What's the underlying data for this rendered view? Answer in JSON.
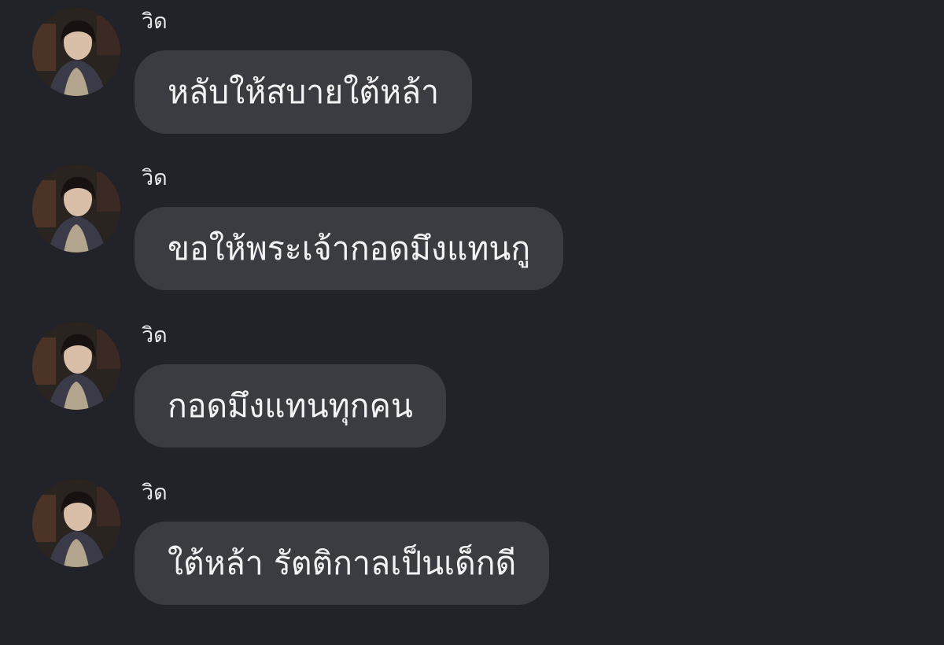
{
  "theme": {
    "background": "#222328",
    "bubble": "#3b3c41",
    "text": "#f3f3f5"
  },
  "messages": [
    {
      "sender": "วิด",
      "avatar_icon": "profile-photo",
      "text": "หลับให้สบายใต้หล้า"
    },
    {
      "sender": "วิด",
      "avatar_icon": "profile-photo",
      "text": "ขอให้พระเจ้ากอดมึงแทนกู"
    },
    {
      "sender": "วิด",
      "avatar_icon": "profile-photo",
      "text": "กอดมึงแทนทุกคน"
    },
    {
      "sender": "วิด",
      "avatar_icon": "profile-photo",
      "text": "ใต้หล้า รัตติกาลเป็นเด็กดี"
    }
  ]
}
